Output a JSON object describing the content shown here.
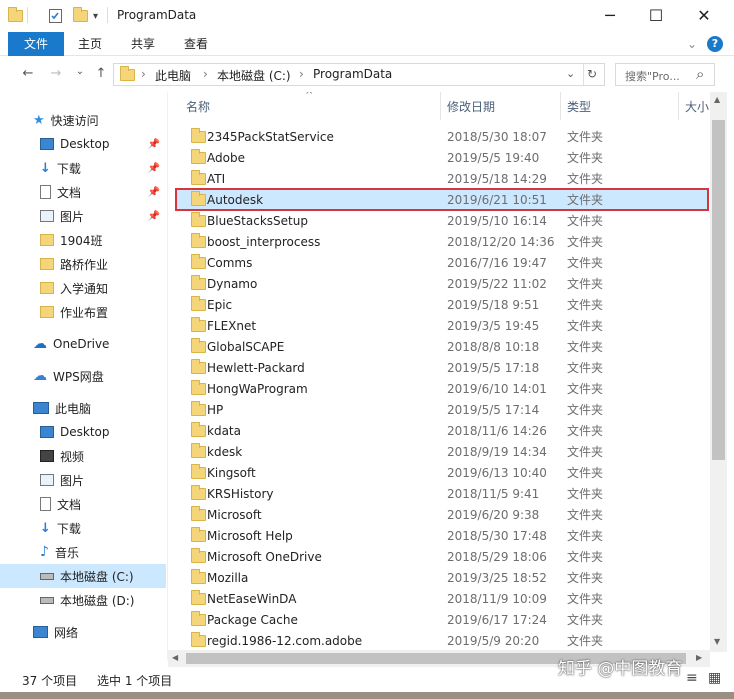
{
  "window": {
    "title": "ProgramData",
    "minimize_icon": "─",
    "maximize_icon": "☐",
    "close_icon": "✕"
  },
  "ribbon": {
    "tabs": [
      "文件",
      "主页",
      "共享",
      "查看"
    ],
    "collapse_icon": "⌄",
    "help_icon": "?"
  },
  "address": {
    "back": "←",
    "forward": "→",
    "recent": "⌄",
    "up": "↑",
    "sep": "›",
    "crumbs": [
      "此电脑",
      "本地磁盘 (C:)",
      "ProgramData"
    ],
    "dropdown": "⌄",
    "refresh": "↻",
    "search_placeholder": "搜索\"Pro...",
    "search_icon": "⌕"
  },
  "sidebar": {
    "items": [
      {
        "label": "快速访问",
        "icon": "star-icon"
      },
      {
        "label": "Desktop",
        "icon": "desktop-icon",
        "pinned": true
      },
      {
        "label": "下载",
        "icon": "download-icon",
        "pinned": true
      },
      {
        "label": "文档",
        "icon": "document-icon",
        "pinned": true
      },
      {
        "label": "图片",
        "icon": "picture-icon",
        "pinned": true
      },
      {
        "label": "1904班",
        "icon": "folder-icon"
      },
      {
        "label": "路桥作业",
        "icon": "folder-icon"
      },
      {
        "label": "入学通知",
        "icon": "folder-icon"
      },
      {
        "label": "作业布置",
        "icon": "folder-icon"
      },
      {
        "label": "OneDrive",
        "icon": "cloud-icon"
      },
      {
        "label": "WPS网盘",
        "icon": "cloud-icon"
      },
      {
        "label": "此电脑",
        "icon": "computer-icon"
      },
      {
        "label": "Desktop",
        "icon": "desktop-icon"
      },
      {
        "label": "视频",
        "icon": "video-icon"
      },
      {
        "label": "图片",
        "icon": "picture-icon"
      },
      {
        "label": "文档",
        "icon": "document-icon"
      },
      {
        "label": "下载",
        "icon": "download-icon"
      },
      {
        "label": "音乐",
        "icon": "music-icon"
      },
      {
        "label": "本地磁盘 (C:)",
        "icon": "drive-icon",
        "selected": true
      },
      {
        "label": "本地磁盘 (D:)",
        "icon": "drive-icon"
      },
      {
        "label": "网络",
        "icon": "network-icon"
      }
    ],
    "pin_icon": "📌"
  },
  "columns": {
    "name": "名称",
    "date": "修改日期",
    "type": "类型",
    "size": "大小",
    "sort_indicator": "^"
  },
  "files": [
    {
      "name": "2345PackStatService",
      "date": "2018/5/30 18:07",
      "type": "文件夹"
    },
    {
      "name": "Adobe",
      "date": "2019/5/5 19:40",
      "type": "文件夹"
    },
    {
      "name": "ATI",
      "date": "2019/5/18 14:29",
      "type": "文件夹"
    },
    {
      "name": "Autodesk",
      "date": "2019/6/21 10:51",
      "type": "文件夹",
      "selected": true
    },
    {
      "name": "BlueStacksSetup",
      "date": "2019/5/10 16:14",
      "type": "文件夹"
    },
    {
      "name": "boost_interprocess",
      "date": "2018/12/20 14:36",
      "type": "文件夹"
    },
    {
      "name": "Comms",
      "date": "2016/7/16 19:47",
      "type": "文件夹"
    },
    {
      "name": "Dynamo",
      "date": "2019/5/22 11:02",
      "type": "文件夹"
    },
    {
      "name": "Epic",
      "date": "2019/5/18 9:51",
      "type": "文件夹"
    },
    {
      "name": "FLEXnet",
      "date": "2019/3/5 19:45",
      "type": "文件夹"
    },
    {
      "name": "GlobalSCAPE",
      "date": "2018/8/8 10:18",
      "type": "文件夹"
    },
    {
      "name": "Hewlett-Packard",
      "date": "2019/5/5 17:18",
      "type": "文件夹"
    },
    {
      "name": "HongWaProgram",
      "date": "2019/6/10 14:01",
      "type": "文件夹"
    },
    {
      "name": "HP",
      "date": "2019/5/5 17:14",
      "type": "文件夹"
    },
    {
      "name": "kdata",
      "date": "2018/11/6 14:26",
      "type": "文件夹"
    },
    {
      "name": "kdesk",
      "date": "2018/9/19 14:34",
      "type": "文件夹"
    },
    {
      "name": "Kingsoft",
      "date": "2019/6/13 10:40",
      "type": "文件夹"
    },
    {
      "name": "KRSHistory",
      "date": "2018/11/5 9:41",
      "type": "文件夹"
    },
    {
      "name": "Microsoft",
      "date": "2019/6/20 9:38",
      "type": "文件夹"
    },
    {
      "name": "Microsoft Help",
      "date": "2018/5/30 17:48",
      "type": "文件夹"
    },
    {
      "name": "Microsoft OneDrive",
      "date": "2018/5/29 18:06",
      "type": "文件夹"
    },
    {
      "name": "Mozilla",
      "date": "2019/3/25 18:52",
      "type": "文件夹"
    },
    {
      "name": "NetEaseWinDA",
      "date": "2018/11/9 10:09",
      "type": "文件夹"
    },
    {
      "name": "Package Cache",
      "date": "2019/6/17 17:24",
      "type": "文件夹"
    },
    {
      "name": "regid.1986-12.com.adobe",
      "date": "2019/5/9 20:20",
      "type": "文件夹"
    }
  ],
  "status": {
    "count": "37 个项目",
    "selected": "选中 1 个项目",
    "view_details_icon": "≡",
    "view_tiles_icon": "▦"
  },
  "scroll": {
    "up": "▲",
    "down": "▼",
    "left": "◀",
    "right": "▶"
  },
  "watermark": "知乎 @中图教育",
  "colors": {
    "accent": "#1979ca",
    "selection": "#cce8ff",
    "highlight_border": "#d8353a",
    "folder": "#f5d57a"
  }
}
